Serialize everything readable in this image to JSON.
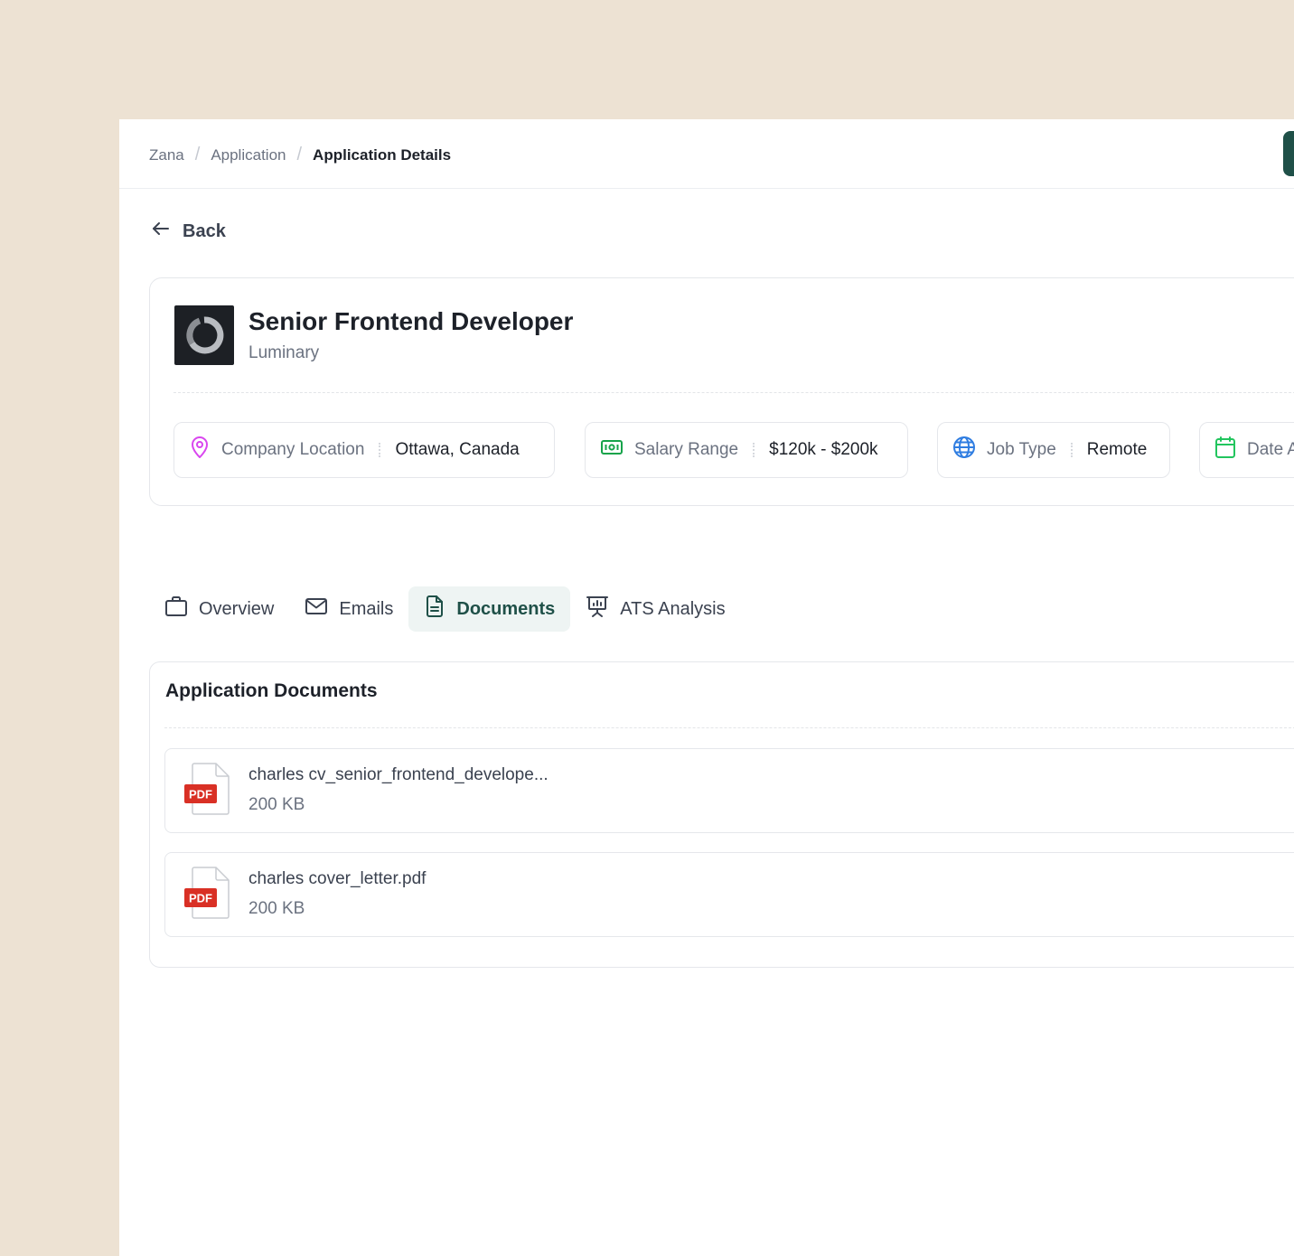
{
  "breadcrumb": {
    "items": [
      "Zana",
      "Application"
    ],
    "current": "Application Details",
    "separator": "/"
  },
  "back": {
    "label": "Back",
    "icon": "arrow-left-icon"
  },
  "job": {
    "title": "Senior Frontend Developer",
    "company": "Luminary",
    "details": [
      {
        "icon": "map-pin-icon",
        "label": "Company Location",
        "value": "Ottawa, Canada",
        "color": "#d946ef"
      },
      {
        "icon": "banknote-icon",
        "label": "Salary Range",
        "value": "$120k - $200k",
        "color": "#16a34a"
      },
      {
        "icon": "globe-icon",
        "label": "Job Type",
        "value": "Remote",
        "color": "#2f7de1"
      },
      {
        "icon": "calendar-icon",
        "label": "Date A",
        "value": "",
        "color": "#22c55e"
      }
    ]
  },
  "tabs": [
    {
      "label": "Overview",
      "icon": "briefcase-icon",
      "active": false
    },
    {
      "label": "Emails",
      "icon": "mail-icon",
      "active": false
    },
    {
      "label": "Documents",
      "icon": "file-text-icon",
      "active": true
    },
    {
      "label": "ATS Analysis",
      "icon": "presentation-chart-icon",
      "active": false
    }
  ],
  "documents": {
    "title": "Application Documents",
    "items": [
      {
        "name": "charles cv_senior_frontend_develope...",
        "size": "200 KB",
        "type": "PDF"
      },
      {
        "name": "charles  cover_letter.pdf",
        "size": "200 KB",
        "type": "PDF"
      }
    ]
  },
  "colors": {
    "accent": "#1f5048",
    "active_tab_bg": "#eef4f3",
    "background": "#ede2d3",
    "pdf_badge": "#d93025"
  }
}
